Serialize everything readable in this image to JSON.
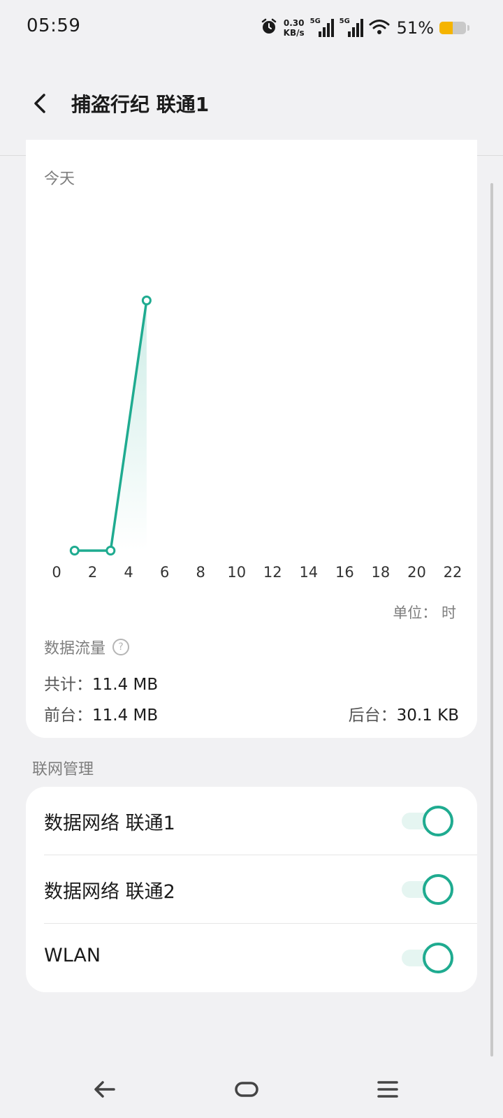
{
  "status_bar": {
    "time": "05:59",
    "net_speed_value": "0.30",
    "net_speed_unit": "KB/s",
    "sim1_label": "5G",
    "sim2_label": "5G",
    "battery_percent_text": "51%",
    "battery_level": 0.51,
    "icons": [
      "alarm-icon",
      "signal-icon",
      "signal-icon",
      "wifi-icon",
      "battery-icon"
    ]
  },
  "header": {
    "title": "捕盗行纪 联通1"
  },
  "usage_card": {
    "period_label": "今天",
    "unit_label": "单位： 时",
    "flow_title": "数据流量",
    "total_label": "共计：",
    "total_value": "11.4 MB",
    "foreground_label": "前台：",
    "foreground_value": "11.4 MB",
    "background_label": "后台：",
    "background_value": "30.1 KB"
  },
  "chart_data": {
    "type": "line",
    "x_ticks": [
      "0",
      "2",
      "4",
      "6",
      "8",
      "10",
      "12",
      "14",
      "16",
      "18",
      "20",
      "22"
    ],
    "x": [
      1,
      3,
      5
    ],
    "series": [
      {
        "values": [
          0,
          0,
          1.0
        ]
      }
    ],
    "xlim": [
      0,
      22
    ],
    "ylim": [
      0,
      1
    ],
    "grid": false,
    "color": "#1fab90"
  },
  "network_section": {
    "label": "联网管理",
    "rows": [
      {
        "label": "数据网络 联通1",
        "enabled": true
      },
      {
        "label": "数据网络 联通2",
        "enabled": true
      },
      {
        "label": "WLAN",
        "enabled": true
      }
    ]
  },
  "colors": {
    "accent": "#1fab90",
    "background": "#f1f1f3",
    "card": "#ffffff",
    "battery": "#f5b400"
  }
}
